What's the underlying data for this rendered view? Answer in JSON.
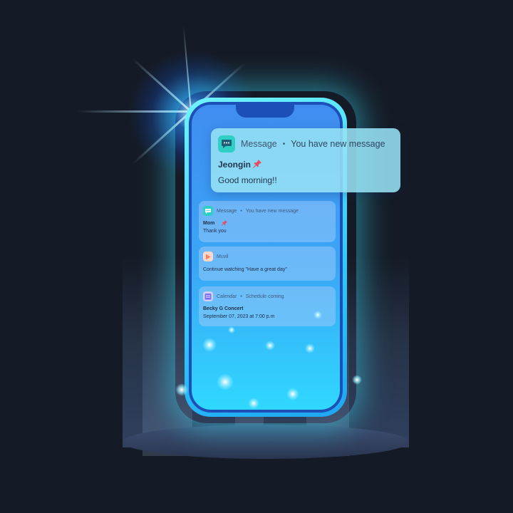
{
  "colors": {
    "background": "#151b26",
    "phone_frame": "#2ec9ff",
    "message_icon": "#2ed0c6",
    "video_icon": "#ff7f63",
    "calendar_icon": "#7b6df0",
    "pin": "#e84a5f"
  },
  "floating_notification": {
    "app": "Message",
    "separator": "•",
    "summary": "You have new message",
    "sender": "Jeongin",
    "text": "Good morning!!",
    "icon": "chat-bubble-icon"
  },
  "notifications": [
    {
      "app": "Message",
      "separator": "•",
      "summary": "You have new message",
      "title": "Mom",
      "body": "Thank you",
      "icon": "chat-bubble-icon"
    },
    {
      "app": "Muvil",
      "separator": "",
      "summary": "",
      "title": "",
      "body": "Continue watching \"Have a great day\"",
      "icon": "play-icon"
    },
    {
      "app": "Calendar",
      "separator": "•",
      "summary": "Schedule coming",
      "title": "Becky G Concert",
      "body": "September 07, 2023 at 7:00 p.m",
      "icon": "calendar-icon"
    }
  ]
}
